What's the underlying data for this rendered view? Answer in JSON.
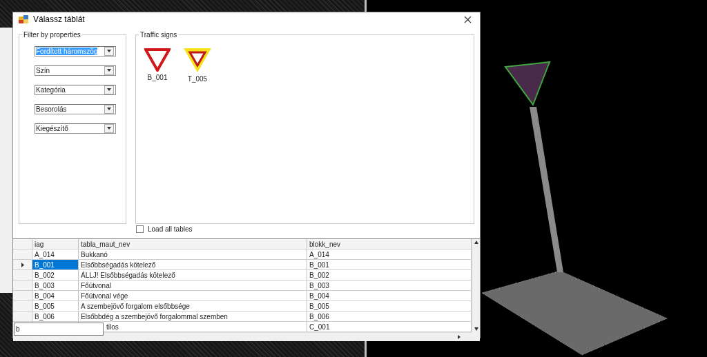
{
  "dialog": {
    "title": "Válassz táblát",
    "filter_group": {
      "title": "Filter by properties",
      "dropdowns": [
        {
          "value": "Fordított háromszög",
          "selected": true
        },
        {
          "value": "Szín",
          "selected": false
        },
        {
          "value": "Kategória",
          "selected": false
        },
        {
          "value": "Besorolás",
          "selected": false
        },
        {
          "value": "Kiegészítő",
          "selected": false
        }
      ]
    },
    "signs_group": {
      "title": "Traffic signs",
      "signs": [
        {
          "label": "B_001",
          "kind": "plain"
        },
        {
          "label": "T_005",
          "kind": "yellow-border"
        }
      ]
    },
    "load_all": {
      "label": "Load all tables",
      "checked": false
    },
    "grid": {
      "columns": [
        "iag",
        "tabla_maut_nev",
        "blokk_nev"
      ],
      "rows": [
        {
          "kind": "normal",
          "selected": false,
          "cells": [
            "A_014",
            "Bukkanó",
            "A_014"
          ]
        },
        {
          "kind": "normal",
          "selected": true,
          "cells": [
            "B_001",
            "Elsőbbségadás kötelező",
            "B_001"
          ]
        },
        {
          "kind": "normal",
          "selected": false,
          "cells": [
            "B_002",
            "ÁLLJ! Elsőbbségadás kötelező",
            "B_002"
          ]
        },
        {
          "kind": "normal",
          "selected": false,
          "cells": [
            "B_003",
            "Főútvonal",
            "B_003"
          ]
        },
        {
          "kind": "normal",
          "selected": false,
          "cells": [
            "B_004",
            "Főútvonal vége",
            "B_004"
          ]
        },
        {
          "kind": "normal",
          "selected": false,
          "cells": [
            "B_005",
            "A szembejövő forgalom elsőbbsége",
            "B_005"
          ]
        },
        {
          "kind": "normal",
          "selected": false,
          "cells": [
            "B_006",
            "Elsőbbdég a szembejövő forgalommal szemben",
            "B_006"
          ]
        },
        {
          "kind": "covered",
          "cells": [
            "",
            "tilos",
            "C_001"
          ]
        }
      ]
    }
  },
  "search_box": {
    "value": "b"
  }
}
